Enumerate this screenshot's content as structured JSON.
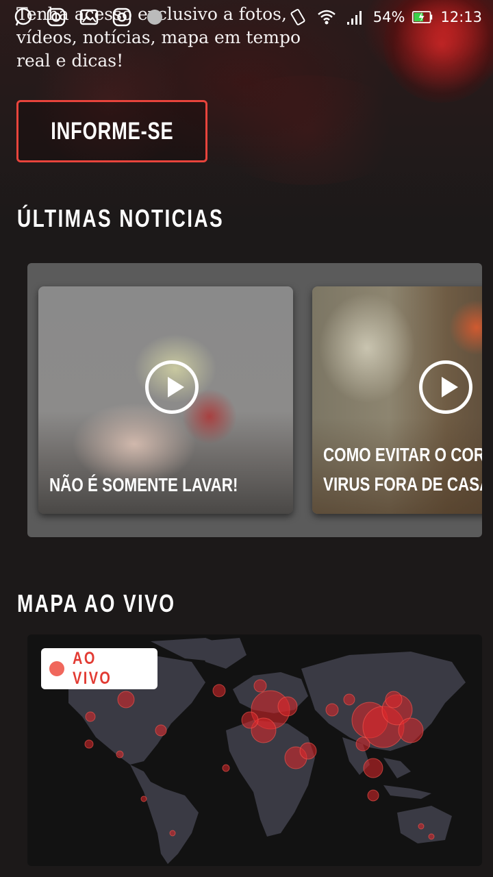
{
  "status_bar": {
    "battery": "54%",
    "time": "12:13",
    "notification_icons": [
      "whatsapp-icon",
      "instagram-icon",
      "gallery-icon",
      "instagram-icon",
      "app-icon"
    ],
    "system_icons": [
      "vibrate-icon",
      "wifi-icon",
      "signal-icon",
      "battery-charging-icon"
    ]
  },
  "hero": {
    "text": "Tenha acesso exclusivo a fotos, vídeos, notícias, mapa em tempo real e dicas!",
    "cta_label": "INFORME-SE"
  },
  "news": {
    "title": "ÚLTIMAS NOTICIAS",
    "cards": [
      {
        "caption": "NÃO É SOMENTE LAVAR!"
      },
      {
        "caption_line1": "COMO EVITAR O CORONA",
        "caption_line2": "VIRUS FORA DE CASA"
      }
    ]
  },
  "map": {
    "title": "MAPA AO VIVO",
    "badge": "AO VIVO"
  },
  "colors": {
    "accent_red": "#e8443c",
    "background": "#1c1919",
    "news_panel": "#5b5b5b",
    "map_land": "#3a3a44",
    "hotspot": "#e0262a"
  }
}
